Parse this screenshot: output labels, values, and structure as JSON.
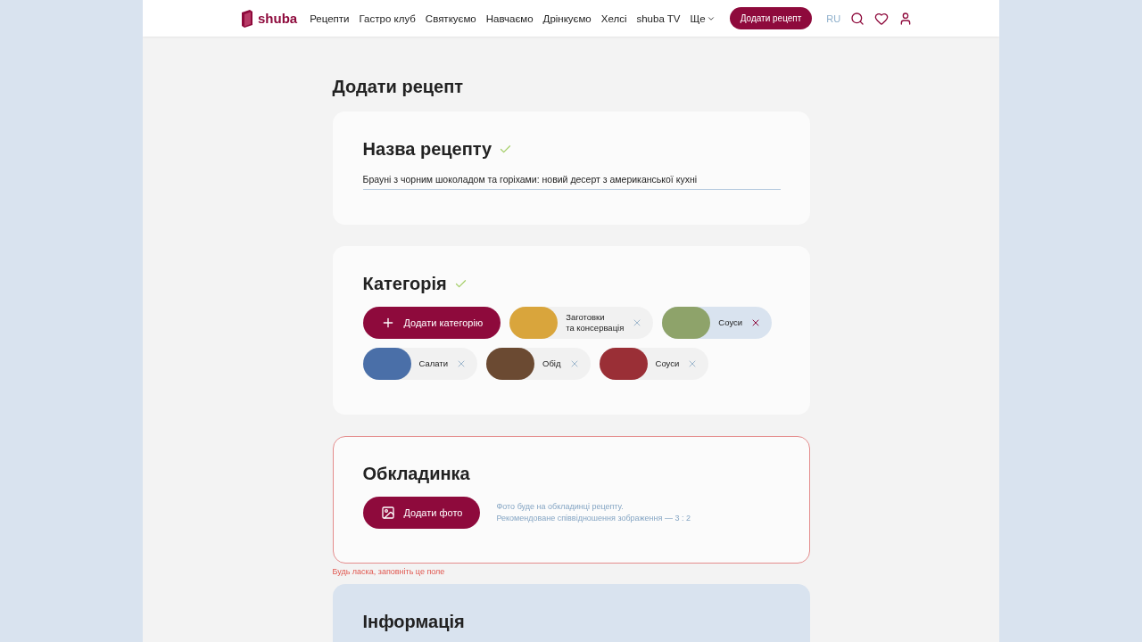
{
  "header": {
    "logo": "shuba",
    "nav": [
      {
        "label": "Рецепти",
        "dropdown": false
      },
      {
        "label": "Гастро клуб",
        "dropdown": false
      },
      {
        "label": "Святкуємо",
        "dropdown": false
      },
      {
        "label": "Навчаємо",
        "dropdown": false
      },
      {
        "label": "Дрінкуємо",
        "dropdown": false
      },
      {
        "label": "Хелсі",
        "dropdown": false
      },
      {
        "label": "shuba TV",
        "dropdown": false
      },
      {
        "label": "Ще",
        "dropdown": true
      }
    ],
    "cta": "Додати рецепт",
    "language": "RU"
  },
  "page_title": "Додати рецепт",
  "sections": [
    {
      "kind": "name",
      "title": "Назва рецепту",
      "valid": true,
      "error": false,
      "highlighted": false,
      "value": "Брауні з чорним шоколадом та горіхами: новий десерт з американської кухні"
    },
    {
      "kind": "categories",
      "title": "Категорія",
      "valid": true,
      "error": false,
      "highlighted": false,
      "add_button": "Додати категорію",
      "chips": [
        {
          "label": "Заготовки\nта консервація",
          "selected": false
        },
        {
          "label": "Соуси",
          "selected": true
        },
        {
          "label": "Салати",
          "selected": false
        },
        {
          "label": "Обід",
          "selected": false
        },
        {
          "label": "Соуси",
          "selected": false
        }
      ]
    },
    {
      "kind": "cover",
      "title": "Обкладинка",
      "valid": false,
      "error": true,
      "highlighted": false,
      "button": "Додати фото",
      "hint": "Фото буде на обкладинці рецепту.\nРекомендоване співвідношення зображення — 3 : 2",
      "error_message": "Будь ласка, заповніть це поле"
    },
    {
      "kind": "info",
      "title": "Інформація",
      "valid": false,
      "error": false,
      "highlighted": true
    }
  ]
}
